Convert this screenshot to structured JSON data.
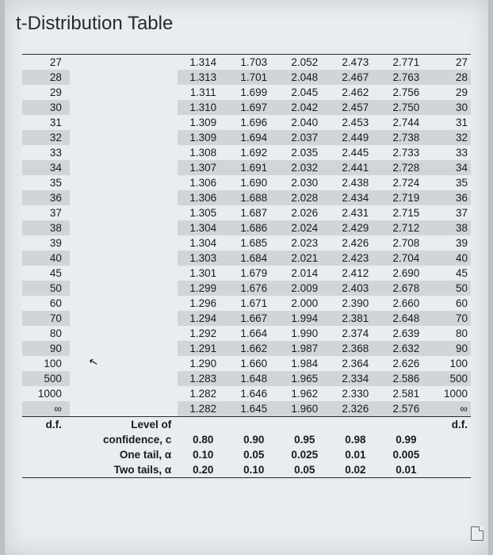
{
  "title": "t-Distribution Table",
  "columns": {
    "headers": [
      "0.80",
      "0.90",
      "0.95",
      "0.98",
      "0.99"
    ]
  },
  "rows": [
    {
      "df": "27",
      "v": [
        "1.314",
        "1.703",
        "2.052",
        "2.473",
        "2.771"
      ],
      "dfr": "27"
    },
    {
      "df": "28",
      "v": [
        "1.313",
        "1.701",
        "2.048",
        "2.467",
        "2.763"
      ],
      "dfr": "28"
    },
    {
      "df": "29",
      "v": [
        "1.311",
        "1.699",
        "2.045",
        "2.462",
        "2.756"
      ],
      "dfr": "29"
    },
    {
      "df": "30",
      "v": [
        "1.310",
        "1.697",
        "2.042",
        "2.457",
        "2.750"
      ],
      "dfr": "30"
    },
    {
      "df": "31",
      "v": [
        "1.309",
        "1.696",
        "2.040",
        "2.453",
        "2.744"
      ],
      "dfr": "31"
    },
    {
      "df": "32",
      "v": [
        "1.309",
        "1.694",
        "2.037",
        "2.449",
        "2.738"
      ],
      "dfr": "32"
    },
    {
      "df": "33",
      "v": [
        "1.308",
        "1.692",
        "2.035",
        "2.445",
        "2.733"
      ],
      "dfr": "33"
    },
    {
      "df": "34",
      "v": [
        "1.307",
        "1.691",
        "2.032",
        "2.441",
        "2.728"
      ],
      "dfr": "34"
    },
    {
      "df": "35",
      "v": [
        "1.306",
        "1.690",
        "2.030",
        "2.438",
        "2.724"
      ],
      "dfr": "35"
    },
    {
      "df": "36",
      "v": [
        "1.306",
        "1.688",
        "2.028",
        "2.434",
        "2.719"
      ],
      "dfr": "36"
    },
    {
      "df": "37",
      "v": [
        "1.305",
        "1.687",
        "2.026",
        "2.431",
        "2.715"
      ],
      "dfr": "37"
    },
    {
      "df": "38",
      "v": [
        "1.304",
        "1.686",
        "2.024",
        "2.429",
        "2.712"
      ],
      "dfr": "38"
    },
    {
      "df": "39",
      "v": [
        "1.304",
        "1.685",
        "2.023",
        "2.426",
        "2.708"
      ],
      "dfr": "39"
    },
    {
      "df": "40",
      "v": [
        "1.303",
        "1.684",
        "2.021",
        "2.423",
        "2.704"
      ],
      "dfr": "40"
    },
    {
      "df": "45",
      "v": [
        "1.301",
        "1.679",
        "2.014",
        "2.412",
        "2.690"
      ],
      "dfr": "45"
    },
    {
      "df": "50",
      "v": [
        "1.299",
        "1.676",
        "2.009",
        "2.403",
        "2.678"
      ],
      "dfr": "50"
    },
    {
      "df": "60",
      "v": [
        "1.296",
        "1.671",
        "2.000",
        "2.390",
        "2.660"
      ],
      "dfr": "60"
    },
    {
      "df": "70",
      "v": [
        "1.294",
        "1.667",
        "1.994",
        "2.381",
        "2.648"
      ],
      "dfr": "70"
    },
    {
      "df": "80",
      "v": [
        "1.292",
        "1.664",
        "1.990",
        "2.374",
        "2.639"
      ],
      "dfr": "80"
    },
    {
      "df": "90",
      "v": [
        "1.291",
        "1.662",
        "1.987",
        "2.368",
        "2.632"
      ],
      "dfr": "90"
    },
    {
      "df": "100",
      "v": [
        "1.290",
        "1.660",
        "1.984",
        "2.364",
        "2.626"
      ],
      "dfr": "100"
    },
    {
      "df": "500",
      "v": [
        "1.283",
        "1.648",
        "1.965",
        "2.334",
        "2.586"
      ],
      "dfr": "500"
    },
    {
      "df": "1000",
      "v": [
        "1.282",
        "1.646",
        "1.962",
        "2.330",
        "2.581"
      ],
      "dfr": "1000"
    },
    {
      "df": "∞",
      "v": [
        "1.282",
        "1.645",
        "1.960",
        "2.326",
        "2.576"
      ],
      "dfr": "∞"
    }
  ],
  "footer": {
    "df_label": "d.f.",
    "rows": [
      {
        "label": "Level of",
        "vals": [
          "",
          "",
          "",
          "",
          ""
        ]
      },
      {
        "label": "confidence, c",
        "vals": [
          "0.80",
          "0.90",
          "0.95",
          "0.98",
          "0.99"
        ]
      },
      {
        "label": "One tail, α",
        "vals": [
          "0.10",
          "0.05",
          "0.025",
          "0.01",
          "0.005"
        ]
      },
      {
        "label": "Two tails, α",
        "vals": [
          "0.20",
          "0.10",
          "0.05",
          "0.02",
          "0.01"
        ]
      }
    ]
  },
  "chart_data": {
    "type": "table",
    "title": "t-Distribution Table (critical values)",
    "column_meta": {
      "confidence_c": [
        0.8,
        0.9,
        0.95,
        0.98,
        0.99
      ],
      "one_tail_alpha": [
        0.1,
        0.05,
        0.025,
        0.01,
        0.005
      ],
      "two_tails_alpha": [
        0.2,
        0.1,
        0.05,
        0.02,
        0.01
      ]
    },
    "data": [
      {
        "df": 27,
        "t": [
          1.314,
          1.703,
          2.052,
          2.473,
          2.771
        ]
      },
      {
        "df": 28,
        "t": [
          1.313,
          1.701,
          2.048,
          2.467,
          2.763
        ]
      },
      {
        "df": 29,
        "t": [
          1.311,
          1.699,
          2.045,
          2.462,
          2.756
        ]
      },
      {
        "df": 30,
        "t": [
          1.31,
          1.697,
          2.042,
          2.457,
          2.75
        ]
      },
      {
        "df": 31,
        "t": [
          1.309,
          1.696,
          2.04,
          2.453,
          2.744
        ]
      },
      {
        "df": 32,
        "t": [
          1.309,
          1.694,
          2.037,
          2.449,
          2.738
        ]
      },
      {
        "df": 33,
        "t": [
          1.308,
          1.692,
          2.035,
          2.445,
          2.733
        ]
      },
      {
        "df": 34,
        "t": [
          1.307,
          1.691,
          2.032,
          2.441,
          2.728
        ]
      },
      {
        "df": 35,
        "t": [
          1.306,
          1.69,
          2.03,
          2.438,
          2.724
        ]
      },
      {
        "df": 36,
        "t": [
          1.306,
          1.688,
          2.028,
          2.434,
          2.719
        ]
      },
      {
        "df": 37,
        "t": [
          1.305,
          1.687,
          2.026,
          2.431,
          2.715
        ]
      },
      {
        "df": 38,
        "t": [
          1.304,
          1.686,
          2.024,
          2.429,
          2.712
        ]
      },
      {
        "df": 39,
        "t": [
          1.304,
          1.685,
          2.023,
          2.426,
          2.708
        ]
      },
      {
        "df": 40,
        "t": [
          1.303,
          1.684,
          2.021,
          2.423,
          2.704
        ]
      },
      {
        "df": 45,
        "t": [
          1.301,
          1.679,
          2.014,
          2.412,
          2.69
        ]
      },
      {
        "df": 50,
        "t": [
          1.299,
          1.676,
          2.009,
          2.403,
          2.678
        ]
      },
      {
        "df": 60,
        "t": [
          1.296,
          1.671,
          2.0,
          2.39,
          2.66
        ]
      },
      {
        "df": 70,
        "t": [
          1.294,
          1.667,
          1.994,
          2.381,
          2.648
        ]
      },
      {
        "df": 80,
        "t": [
          1.292,
          1.664,
          1.99,
          2.374,
          2.639
        ]
      },
      {
        "df": 90,
        "t": [
          1.291,
          1.662,
          1.987,
          2.368,
          2.632
        ]
      },
      {
        "df": 100,
        "t": [
          1.29,
          1.66,
          1.984,
          2.364,
          2.626
        ]
      },
      {
        "df": 500,
        "t": [
          1.283,
          1.648,
          1.965,
          2.334,
          2.586
        ]
      },
      {
        "df": 1000,
        "t": [
          1.282,
          1.646,
          1.962,
          2.33,
          2.581
        ]
      },
      {
        "df": "infinity",
        "t": [
          1.282,
          1.645,
          1.96,
          2.326,
          2.576
        ]
      }
    ]
  }
}
